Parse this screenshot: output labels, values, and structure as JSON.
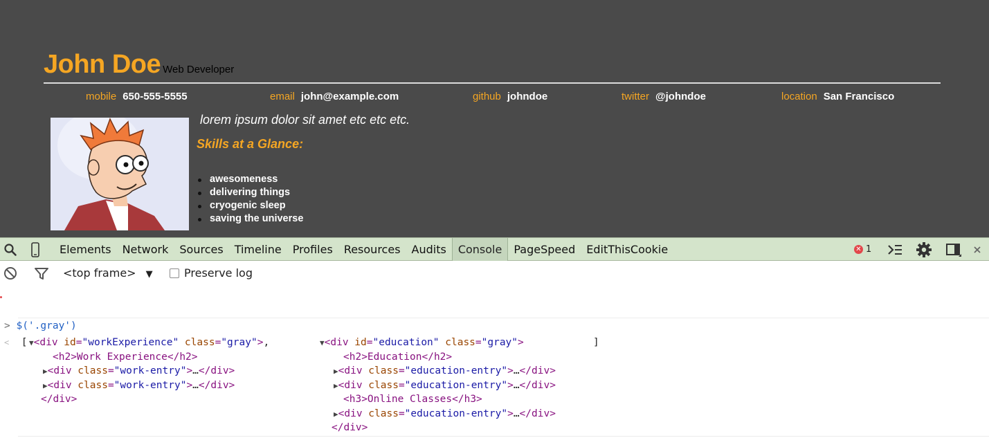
{
  "resume": {
    "name": "John Doe",
    "role": "Web Developer",
    "contacts": [
      {
        "label": "mobile",
        "value": "650-555-5555"
      },
      {
        "label": "email",
        "value": "john@example.com"
      },
      {
        "label": "github",
        "value": "johndoe"
      },
      {
        "label": "twitter",
        "value": "@johndoe"
      },
      {
        "label": "location",
        "value": "San Francisco"
      }
    ],
    "intro": "lorem ipsum dolor sit amet etc etc etc.",
    "skills_heading": "Skills at a Glance:",
    "skills": [
      "awesomeness",
      "delivering things",
      "cryogenic sleep",
      "saving the universe"
    ],
    "colors": {
      "background": "#4a4a4a",
      "accent": "#f5a623",
      "text": "#ffffff"
    }
  },
  "devtools": {
    "tabs": [
      "Elements",
      "Network",
      "Sources",
      "Timeline",
      "Profiles",
      "Resources",
      "Audits",
      "Console",
      "PageSpeed",
      "EditThisCookie"
    ],
    "active_tab": "Console",
    "error_count": "1",
    "icons": [
      "search-icon",
      "device-mode-icon",
      "console-drawer-icon",
      "settings-gear-icon",
      "dock-side-icon",
      "close-icon",
      "clear-console-icon",
      "filter-icon"
    ],
    "frame_selector": "<top frame>",
    "preserve_log": {
      "label": "Preserve log",
      "checked": false
    },
    "console": {
      "prompt": ">",
      "command": "$('.gray')",
      "result_open": "[",
      "result_close": "]",
      "separator": ",",
      "ellipsis": "…",
      "left": {
        "tag_open": "div",
        "id_attr": "id",
        "id_value": "\"workExperience\"",
        "class_attr": "class",
        "class_value": "\"gray\"",
        "heading": "<h2>Work Experience</h2>",
        "children": [
          {
            "class_value": "\"work-entry\""
          },
          {
            "class_value": "\"work-entry\""
          }
        ],
        "close": "</div>"
      },
      "right": {
        "id_value": "\"education\"",
        "class_value": "\"gray\"",
        "heading": "<h2>Education</h2>",
        "children": [
          {
            "class_value": "\"education-entry\""
          },
          {
            "class_value": "\"education-entry\""
          }
        ],
        "subheading": "<h3>Online Classes</h3>",
        "last_child": {
          "class_value": "\"education-entry\""
        },
        "close": "</div>"
      }
    },
    "colors": {
      "tabbar": "#d4e4cb",
      "error": "#e2474b",
      "tag": "#881280",
      "attr": "#994500",
      "value": "#1a1aa6",
      "command": "#2160c4"
    }
  }
}
